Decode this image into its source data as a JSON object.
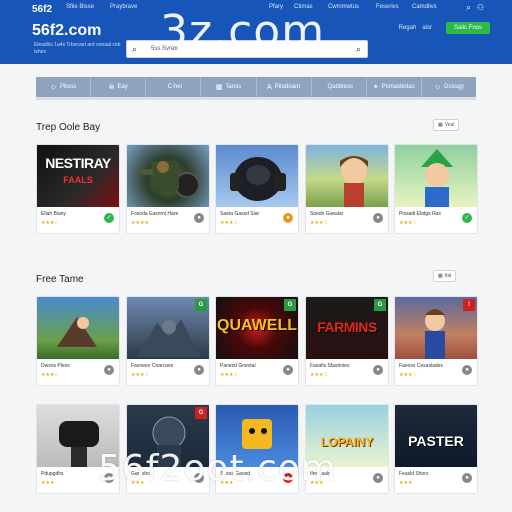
{
  "header": {
    "logo_small": "56f2",
    "nav": [
      "Sfiie Bisse",
      "Praybrave",
      "Pfary",
      "Ctimas",
      "Cwmmwtus",
      "Feserivs",
      "Camdiivs"
    ],
    "site_title": "56f2.com",
    "tagline": "Ebosibls 1a4s Trbecaet ard oonaal ceb tshes",
    "watermark": "3z.com",
    "search": {
      "text": "5ss  Svreb"
    },
    "links": [
      "Regah",
      "aisr"
    ],
    "signup": "Saiic Fnos"
  },
  "categories": [
    {
      "icon": "☺",
      "label": "Pitoss"
    },
    {
      "icon": "⊗",
      "label": "Eay"
    },
    {
      "icon": "",
      "label": "C-hel"
    },
    {
      "icon": "▦",
      "label": "Tanss"
    },
    {
      "icon": "A",
      "label": "Pitodoam"
    },
    {
      "icon": "",
      "label": "Qabbless"
    },
    {
      "icon": "✶",
      "label": "Psmasbotas"
    },
    {
      "icon": "☺",
      "label": "Dsssgy"
    }
  ],
  "section1": {
    "title": "Trep Oole Bay",
    "view_all": "Veal",
    "cards": [
      {
        "title": "Eliah Biany",
        "overlay": "NESTIRAY\nFAALS",
        "stars": "★★★☆",
        "btn": "✓",
        "btn_color": "#2db84a"
      },
      {
        "title": "Fosoda Easrirnl Hare",
        "overlay": "",
        "stars": "★★★★",
        "btn": "●",
        "btn_color": "#888888"
      },
      {
        "title": "Saeta Gassd Siar",
        "overlay": "",
        "stars": "★★★☆",
        "btn": "●",
        "btn_color": "#e89a1a"
      },
      {
        "title": "Soeds Guealar",
        "overlay": "",
        "stars": "★★★☆",
        "btn": "●",
        "btn_color": "#888888"
      },
      {
        "title": "Pissadi Ebdgs Rax",
        "overlay": "",
        "stars": "★★★☆",
        "btn": "✓",
        "btn_color": "#2db84a"
      }
    ]
  },
  "section2": {
    "title": "Free Tame",
    "view_all": "Ital",
    "cards": [
      {
        "title": "Dwsns Pleos",
        "overlay": "",
        "stars": "★★★☆",
        "btn": "●",
        "btn_color": "#888888"
      },
      {
        "title": "Fasneeo Cnarcaes",
        "overlay": "",
        "stars": "★★★☆",
        "btn": "●",
        "btn_color": "#888888"
      },
      {
        "title": "Panesd Gnevtal",
        "overlay": "QUAWELL",
        "stars": "★★★☆",
        "btn": "●",
        "btn_color": "#888888"
      },
      {
        "title": "Fasafis Sfasrinies",
        "overlay": "FARMINS",
        "stars": "★★★☆",
        "btn": "●",
        "btn_color": "#888888"
      },
      {
        "title": "Faeoss Cesaslades",
        "overlay": "",
        "stars": "★★★☆",
        "btn": "●",
        "btn_color": "#888888"
      }
    ]
  },
  "section3": {
    "cards": [
      {
        "title": "Pdupgdhs",
        "overlay": "",
        "stars": "★★★",
        "btn": "●",
        "btn_color": "#888888"
      },
      {
        "title": "Gan sho",
        "overlay": "",
        "stars": "★★★",
        "btn": "●",
        "btn_color": "#888888"
      },
      {
        "title": "Spess Gaosd",
        "overlay": "",
        "stars": "★★★",
        "btn": "●",
        "btn_color": "#888888"
      },
      {
        "title": "Iferd aalrs",
        "overlay": "LOPAINY",
        "stars": "★★★",
        "btn": "●",
        "btn_color": "#888888"
      },
      {
        "title": "Feasld Shors",
        "overlay": "PASTER",
        "stars": "★★★",
        "btn": "●",
        "btn_color": "#888888"
      }
    ]
  },
  "bottom_watermark": "56f2oot.com"
}
